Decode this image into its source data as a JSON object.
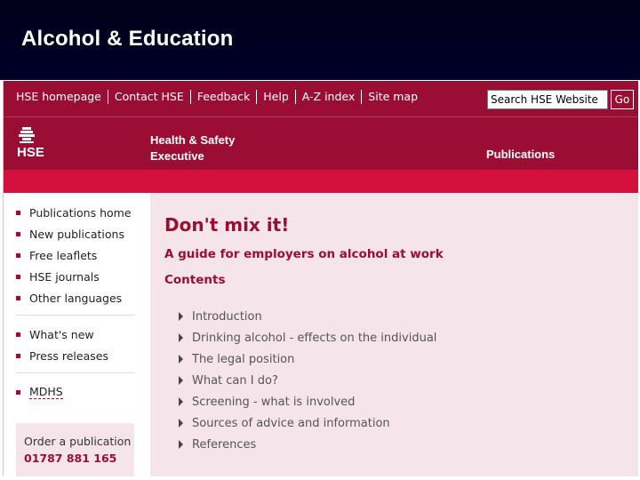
{
  "slide": {
    "title": "Alcohol & Education"
  },
  "topnav": {
    "links": [
      "HSE homepage",
      "Contact HSE",
      "Feedback",
      "Help",
      "A-Z index",
      "Site map"
    ],
    "search_value": "Search HSE Website",
    "go_label": "Go"
  },
  "brand": {
    "logo_text": "HSE",
    "org_name": "Health & Safety\nExecutive",
    "section": "Publications"
  },
  "sidebar": {
    "group1": [
      "Publications home",
      "New publications",
      "Free leaflets",
      "HSE journals",
      "Other languages"
    ],
    "group2": [
      "What's new",
      "Press releases"
    ],
    "group3": [
      "MDHS"
    ],
    "order_label": "Order a publication",
    "order_phone": "01787 881 165"
  },
  "main": {
    "title": "Don't mix it!",
    "subtitle": "A guide for employers on alcohol at work",
    "contents_heading": "Contents",
    "toc": [
      "Introduction",
      "Drinking alcohol - effects on the individual",
      "The legal position",
      "What can I do?",
      "Screening - what is involved",
      "Sources of advice and information",
      "References"
    ]
  },
  "colors": {
    "brand": "#9b0e33",
    "accent": "#d4103d",
    "content_bg": "#f5e4ea",
    "title_bar": "#000020"
  },
  "icons": {
    "logo": "hse-crest-icon",
    "nav_bullet": "square-bullet-icon",
    "toc_arrow": "triangle-right-icon"
  }
}
